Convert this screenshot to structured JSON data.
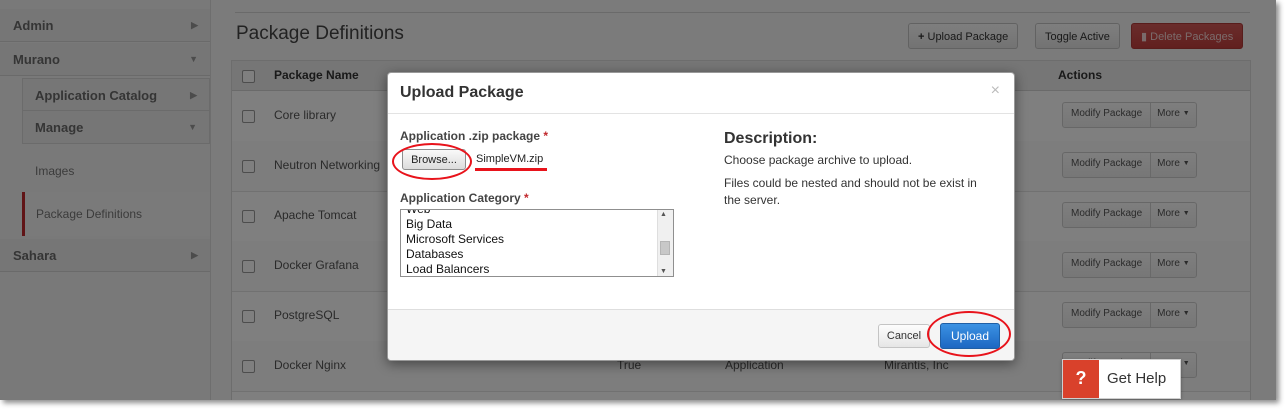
{
  "sidebar": {
    "admin": "Admin",
    "murano": "Murano",
    "app_catalog": "Application Catalog",
    "manage": "Manage",
    "images": "Images",
    "package_definitions": "Package Definitions",
    "sahara": "Sahara"
  },
  "main": {
    "title": "Package Definitions",
    "upload_package_label": "Upload Package",
    "toggle_active_label": "Toggle Active",
    "delete_packages_label": "Delete Packages",
    "columns": {
      "package_name": "Package Name",
      "actions": "Actions"
    },
    "rows": [
      {
        "name": "Core library",
        "active": "",
        "type": "",
        "author": ""
      },
      {
        "name": "Neutron Networking",
        "active": "",
        "type": "",
        "author": ""
      },
      {
        "name": "Apache Tomcat",
        "active": "",
        "type": "",
        "author": ""
      },
      {
        "name": "Docker Grafana",
        "active": "",
        "type": "",
        "author": ""
      },
      {
        "name": "PostgreSQL",
        "active": "",
        "type": "",
        "author": ""
      },
      {
        "name": "Docker Nginx",
        "active": "True",
        "type": "Application",
        "author": "Mirantis, Inc"
      }
    ],
    "modify_label": "Modify Package",
    "more_label": "More"
  },
  "modal": {
    "title": "Upload Package",
    "close_glyph": "×",
    "zip_label": "Application .zip package",
    "required_mark": "*",
    "browse_label": "Browse...",
    "file_name": "SimpleVM.zip",
    "category_label": "Application Category",
    "categories": [
      "Web",
      "Big Data",
      "Microsoft Services",
      "Databases",
      "Load Balancers"
    ],
    "description_title": "Description:",
    "description_line1": "Choose package archive to upload.",
    "description_line2": "Files could be nested and should not be exist in the server.",
    "cancel_label": "Cancel",
    "upload_label": "Upload"
  },
  "help": {
    "icon": "?",
    "label": "Get Help"
  },
  "colors": {
    "annotation": "#e8131b",
    "primary": "#1d67c2",
    "danger": "#c33f3d",
    "help": "#d9412b"
  }
}
